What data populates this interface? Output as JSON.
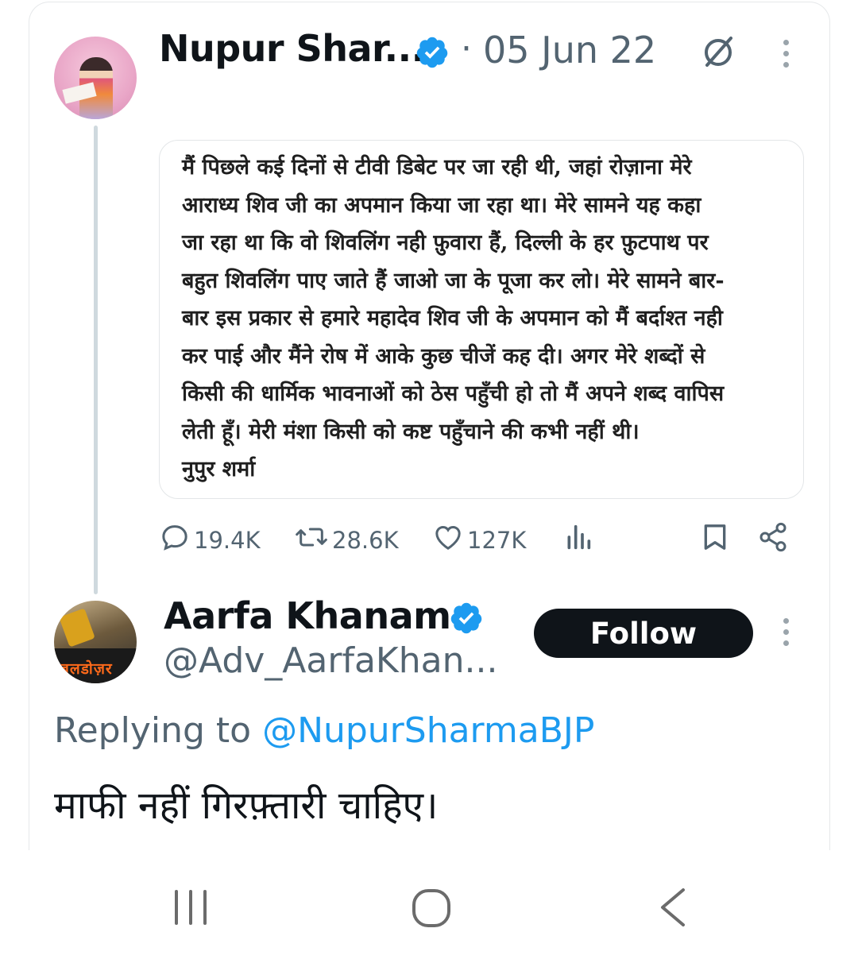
{
  "tweet": {
    "author_name": "Nupur Shar...",
    "separator": "·",
    "date": "05 Jun 22",
    "quote_text": "मैं पिछले कई दिनों से टीवी डिबेट पर जा रही थी, जहां रोज़ाना मेरे\nआराध्य शिव जी का अपमान किया जा रहा था। मेरे सामने यह कहा\nजा रहा था कि वो शिवलिंग नही फ़ुवारा हैं, दिल्ली के हर फ़ुटपाथ पर\nबहुत शिवलिंग पाए जाते हैं जाओ जा के पूजा कर लो। मेरे सामने बार-\nबार इस प्रकार से हमारे महादेव शिव जी के अपमान को मैं बर्दाश्त नही\nकर पाई और मैंने रोष में आके कुछ चीजें कह दी। अगर मेरे शब्दों से\nकिसी की धार्मिक भावनाओं को ठेस पहुँची हो तो मैं अपने शब्द वापिस\nलेती हूँ। मेरी मंशा किसी को कष्ट पहुँचाने की कभी नहीं थी।\nनुपुर शर्मा",
    "stats": {
      "replies": "19.4K",
      "reposts": "28.6K",
      "likes": "127K"
    },
    "icons": [
      "verified-badge-icon",
      "edit-history-icon",
      "more-icon",
      "reply-icon",
      "repost-icon",
      "like-icon",
      "views-icon",
      "bookmark-icon",
      "share-icon"
    ]
  },
  "reply": {
    "author_name": "Aarfa Khanam",
    "handle": "@Adv_AarfaKhan...",
    "avatar_banner_text": "बलडोज़र",
    "follow_label": "Follow",
    "replying_prefix": "Replying to",
    "replying_mention": "@NupurSharmaBJP",
    "text": "माफी नहीं गिरफ़्तारी चाहिए।"
  },
  "navbar": {
    "icons": [
      "recent-apps-icon",
      "home-icon",
      "back-icon"
    ]
  },
  "colors": {
    "verified": "#1d9bf0",
    "mention": "#1d9bf0",
    "muted": "#536471",
    "button_bg": "#0f1419"
  }
}
